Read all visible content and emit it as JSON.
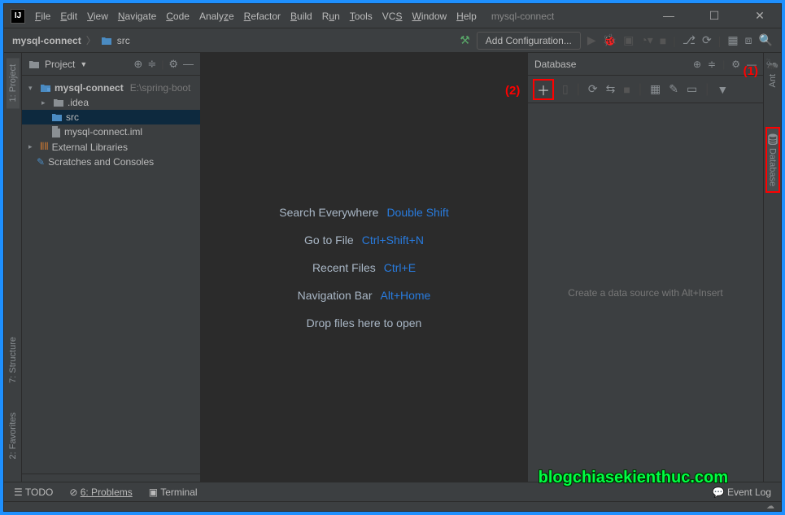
{
  "title_project": "mysql-connect",
  "menu": [
    "File",
    "Edit",
    "View",
    "Navigate",
    "Code",
    "Analyze",
    "Refactor",
    "Build",
    "Run",
    "Tools",
    "VCS",
    "Window",
    "Help"
  ],
  "breadcrumb": {
    "project": "mysql-connect",
    "folder": "src"
  },
  "toolbar": {
    "add_config": "Add Configuration..."
  },
  "project_panel": {
    "title": "Project",
    "items": {
      "root": "mysql-connect",
      "root_path": "E:\\spring-boot",
      "idea": ".idea",
      "src": "src",
      "iml": "mysql-connect.iml",
      "ext": "External Libraries",
      "scratch": "Scratches and Consoles"
    }
  },
  "editor_hints": {
    "search": {
      "label": "Search Everywhere",
      "key": "Double Shift"
    },
    "goto": {
      "label": "Go to File",
      "key": "Ctrl+Shift+N"
    },
    "recent": {
      "label": "Recent Files",
      "key": "Ctrl+E"
    },
    "navbar": {
      "label": "Navigation Bar",
      "key": "Alt+Home"
    },
    "drop": "Drop files here to open"
  },
  "db_panel": {
    "title": "Database",
    "placeholder": "Create a data source with Alt+Insert"
  },
  "sidebar_left": {
    "project": "1: Project",
    "structure": "7: Structure",
    "fav": "2: Favorites"
  },
  "sidebar_right": {
    "ant": "Ant",
    "database": "Database"
  },
  "status": {
    "todo": "TODO",
    "problems": "6: Problems",
    "terminal": "Terminal",
    "event": "Event Log"
  },
  "annotations": {
    "one": "(1)",
    "two": "(2)"
  },
  "watermark": "blogchiasekienthuc.com"
}
